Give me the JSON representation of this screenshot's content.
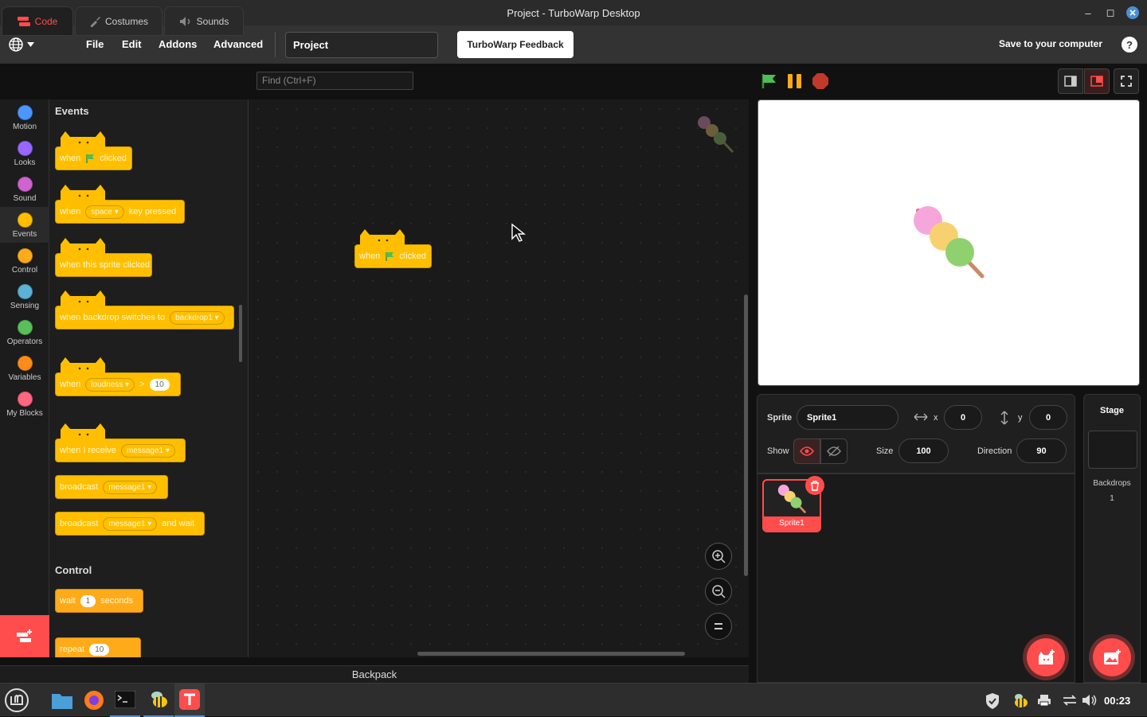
{
  "window": {
    "title": "Project - TurboWarp Desktop"
  },
  "menu": {
    "file": "File",
    "edit": "Edit",
    "addons": "Addons",
    "advanced": "Advanced",
    "project_title": "Project",
    "feedback": "TurboWarp Feedback",
    "save": "Save to your computer",
    "help": "?"
  },
  "tabs": {
    "code": "Code",
    "costumes": "Costumes",
    "sounds": "Sounds"
  },
  "find": {
    "placeholder": "Find (Ctrl+F)"
  },
  "categories": [
    {
      "label": "Motion",
      "color": "#4c97ff"
    },
    {
      "label": "Looks",
      "color": "#9966ff"
    },
    {
      "label": "Sound",
      "color": "#cf63cf"
    },
    {
      "label": "Events",
      "color": "#ffbf00"
    },
    {
      "label": "Control",
      "color": "#ffab19"
    },
    {
      "label": "Sensing",
      "color": "#5cb1d6"
    },
    {
      "label": "Operators",
      "color": "#59c059"
    },
    {
      "label": "Variables",
      "color": "#ff8c1a"
    },
    {
      "label": "My Blocks",
      "color": "#ff6680"
    }
  ],
  "palette": {
    "events_heading": "Events",
    "control_heading": "Control",
    "when": "when",
    "clicked": "clicked",
    "space": "space",
    "key_pressed": "key pressed",
    "sprite_clicked": "when this sprite clicked",
    "backdrop_switches": "when backdrop switches to",
    "backdrop1": "backdrop1",
    "loudness": "loudness",
    "gt": ">",
    "ten": "10",
    "receive": "when I receive",
    "message1": "message1",
    "broadcast": "broadcast",
    "and_wait": "and wait",
    "wait": "wait",
    "one": "1",
    "seconds": "seconds",
    "repeat": "repeat"
  },
  "workspace": {
    "block_when": "when",
    "block_clicked": "clicked"
  },
  "backpack": "Backpack",
  "sprite": {
    "label": "Sprite",
    "name": "Sprite1",
    "x_label": "x",
    "x": "0",
    "y_label": "y",
    "y": "0",
    "show_label": "Show",
    "size_label": "Size",
    "size": "100",
    "direction_label": "Direction",
    "direction": "90",
    "tile_name": "Sprite1"
  },
  "stage_panel": {
    "title": "Stage",
    "backdrops_label": "Backdrops",
    "backdrops_count": "1"
  },
  "taskbar": {
    "clock": "00:23"
  },
  "colors": {
    "accent": "#ff4c4c",
    "events": "#ffbf00",
    "flag": "#4cbf56"
  }
}
